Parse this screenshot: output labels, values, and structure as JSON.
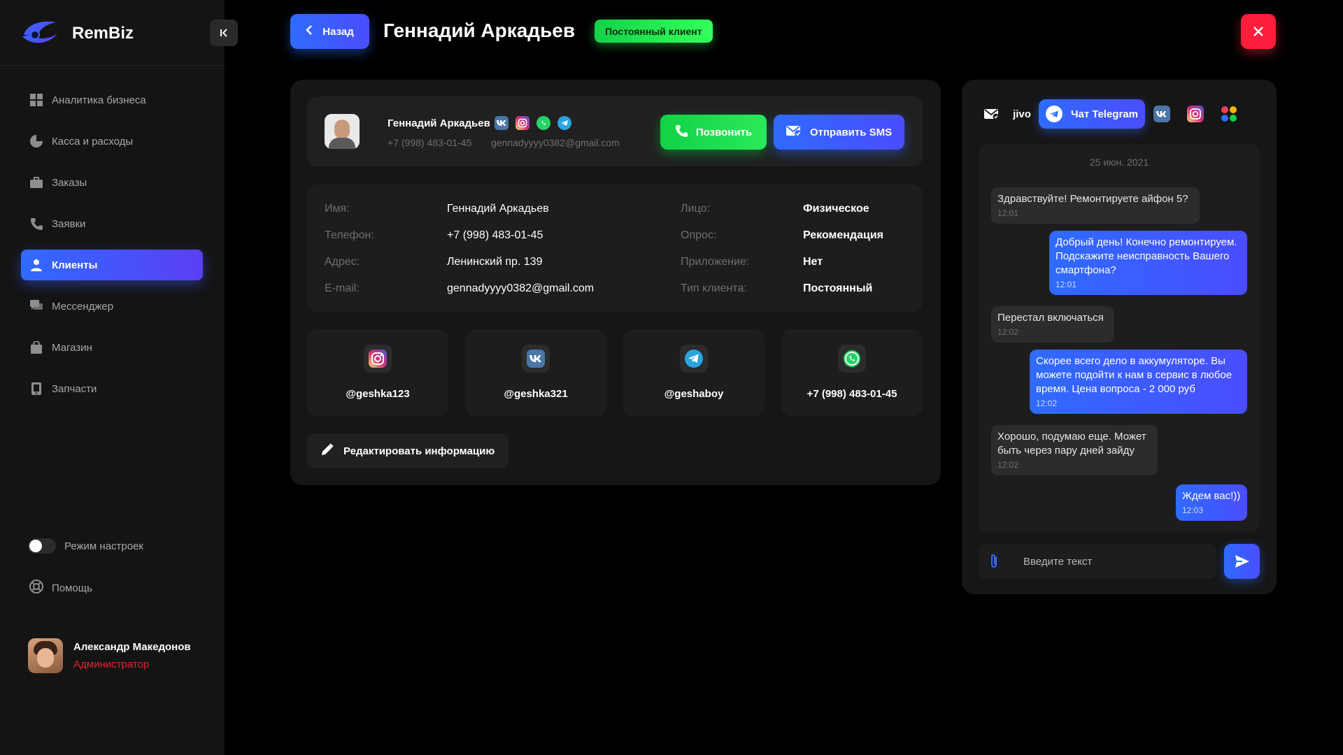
{
  "app": {
    "name": "RemBiz"
  },
  "sidebar": {
    "items": [
      {
        "label": "Аналитика бизнеса",
        "icon": "grid-icon"
      },
      {
        "label": "Касса и расходы",
        "icon": "pie-chart-icon"
      },
      {
        "label": "Заказы",
        "icon": "briefcase-icon"
      },
      {
        "label": "Заявки",
        "icon": "phone-icon"
      },
      {
        "label": "Клиенты",
        "icon": "user-icon",
        "active": true
      },
      {
        "label": "Мессенджер",
        "icon": "chat-icon"
      },
      {
        "label": "Магазин",
        "icon": "shopping-bag-icon"
      },
      {
        "label": "Запчасти",
        "icon": "device-icon"
      }
    ],
    "settings_mode_label": "Режим настроек",
    "help_label": "Помощь",
    "user": {
      "name": "Александр Македонов",
      "role": "Администратор"
    }
  },
  "header": {
    "back_label": "Назад",
    "title": "Геннадий Аркадьев",
    "status_badge": "Постоянный клиент"
  },
  "client": {
    "name": "Геннадий Аркадьев",
    "phone": "+7 (998) 483-01-45",
    "email": "gennadyyyy0382@gmail.com",
    "call_label": "Позвонить",
    "sms_label": "Отправить SMS"
  },
  "info": {
    "left": [
      {
        "label": "Имя:",
        "value": "Геннадий Аркадьев"
      },
      {
        "label": "Телефон:",
        "value": "+7 (998) 483-01-45"
      },
      {
        "label": "Адрес:",
        "value": "Ленинский пр. 139"
      },
      {
        "label": "E-mail:",
        "value": "gennadyyyy0382@gmail.com"
      }
    ],
    "right": [
      {
        "label": "Лицо:",
        "value": "Физическое"
      },
      {
        "label": "Опрос:",
        "value": "Рекомендация"
      },
      {
        "label": "Приложение:",
        "value": "Нет"
      },
      {
        "label": "Тип клиента:",
        "value": "Постоянный"
      }
    ]
  },
  "socials": [
    {
      "network": "instagram",
      "handle": "@geshka123"
    },
    {
      "network": "vk",
      "handle": "@geshka321"
    },
    {
      "network": "telegram",
      "handle": "@geshaboy"
    },
    {
      "network": "whatsapp",
      "handle": "+7 (998) 483-01-45"
    }
  ],
  "edit_label": "Редактировать информацию",
  "chat": {
    "channels": {
      "jivo_label": "jivo",
      "telegram_label": "Чат Telegram"
    },
    "date": "25 июн. 2021",
    "messages": [
      {
        "dir": "in",
        "text": "Здравствуйте! Ремонтируете айфон 5?",
        "time": "12:01"
      },
      {
        "dir": "out",
        "text": "Добрый день! Конечно ремонтируем. Подскажите неисправность Вашего смартфона?",
        "time": "12:01"
      },
      {
        "dir": "in",
        "text": "Перестал включаться",
        "time": "12:02"
      },
      {
        "dir": "out",
        "text": "Скорее всего дело в аккумуляторе. Вы можете подойти к нам в сервис в любое время. Цена вопроса - 2 000 руб",
        "time": "12:02"
      },
      {
        "dir": "in",
        "text": "Хорошо, подумаю еще. Может быть через пару дней зайду",
        "time": "12:02"
      },
      {
        "dir": "out",
        "text": "Ждем вас!))",
        "time": "12:03"
      }
    ],
    "input_placeholder": "Введите текст"
  },
  "colors": {
    "accent_blue": "#2f6bff",
    "success_green": "#14d14a",
    "danger_red": "#ff1e3c",
    "role_red": "#e2232f"
  }
}
